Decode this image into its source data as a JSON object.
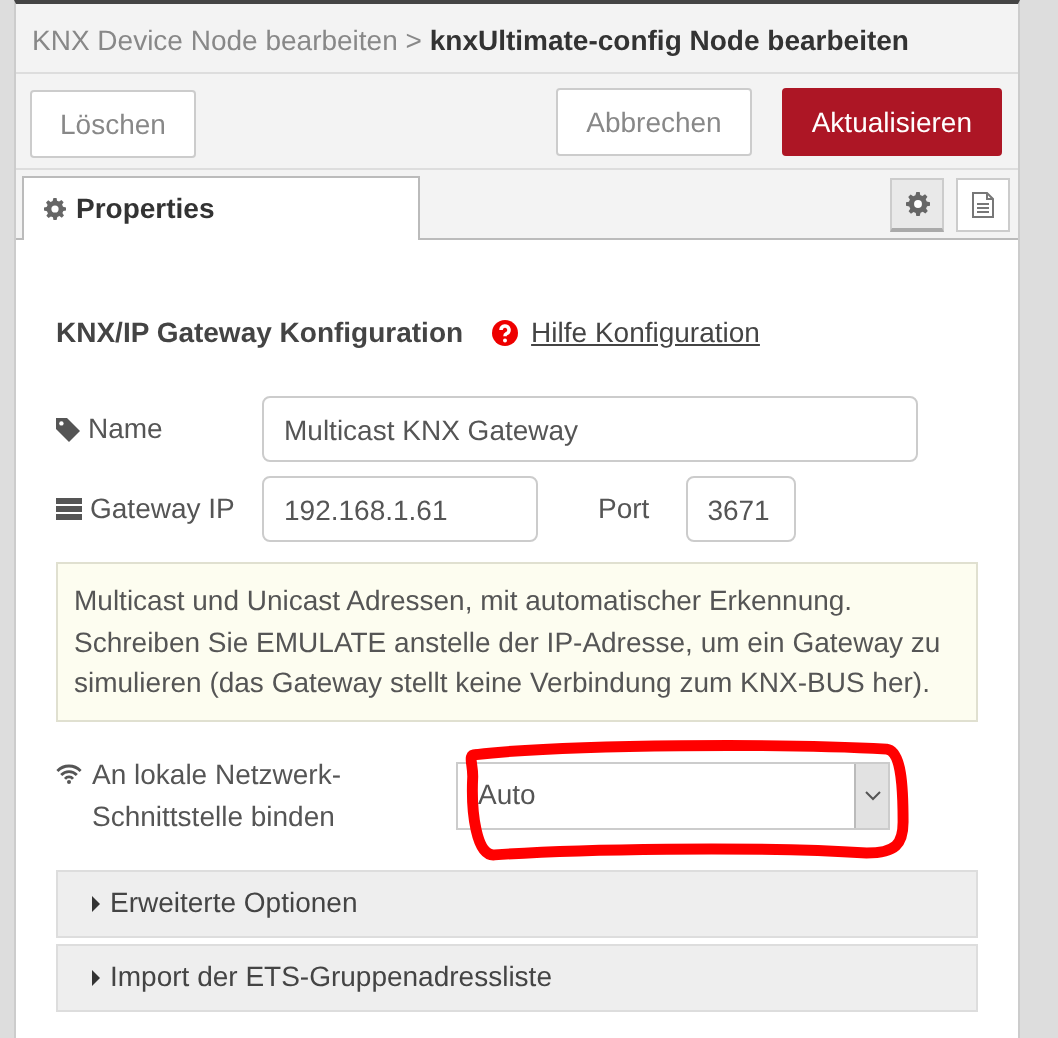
{
  "breadcrumb": {
    "parent": "KNX Device Node bearbeiten",
    "separator": ">",
    "current": "knxUltimate-config Node bearbeiten"
  },
  "buttons": [
    {
      "label": "Löschen",
      "kind": "default"
    },
    {
      "label": "Abbrechen",
      "kind": "default"
    },
    {
      "label": "Aktualisieren",
      "kind": "primary"
    }
  ],
  "tabs": [
    {
      "label": "Properties",
      "selected": true
    }
  ],
  "tab_tools": [
    {
      "kind": "settings",
      "selected": true
    },
    {
      "kind": "description",
      "selected": false
    }
  ],
  "section": {
    "title": "KNX/IP Gateway Konfiguration",
    "help_link": "Hilfe Konfiguration"
  },
  "fields": [
    {
      "label": "Name",
      "value": "Multicast KNX Gateway"
    },
    {
      "label": "Gateway IP",
      "value": "192.168.1.61"
    },
    {
      "label": "Port",
      "value": "3671"
    }
  ],
  "info": "Multicast und Unicast Adressen, mit automatischer Erkennung. Schreiben Sie EMULATE anstelle der IP-Adresse, um ein Gateway zu simulieren (das Gateway stellt keine Verbindung zum KNX-BUS her).",
  "interface_select": {
    "label": "An lokale Netzwerk-Schnittstelle binden",
    "value": "Auto",
    "circled": true
  },
  "sections": [
    {
      "label": "Erweiterte Optionen",
      "expanded": false
    },
    {
      "label": "Import der ETS-Gruppenadressliste",
      "expanded": false
    }
  ]
}
